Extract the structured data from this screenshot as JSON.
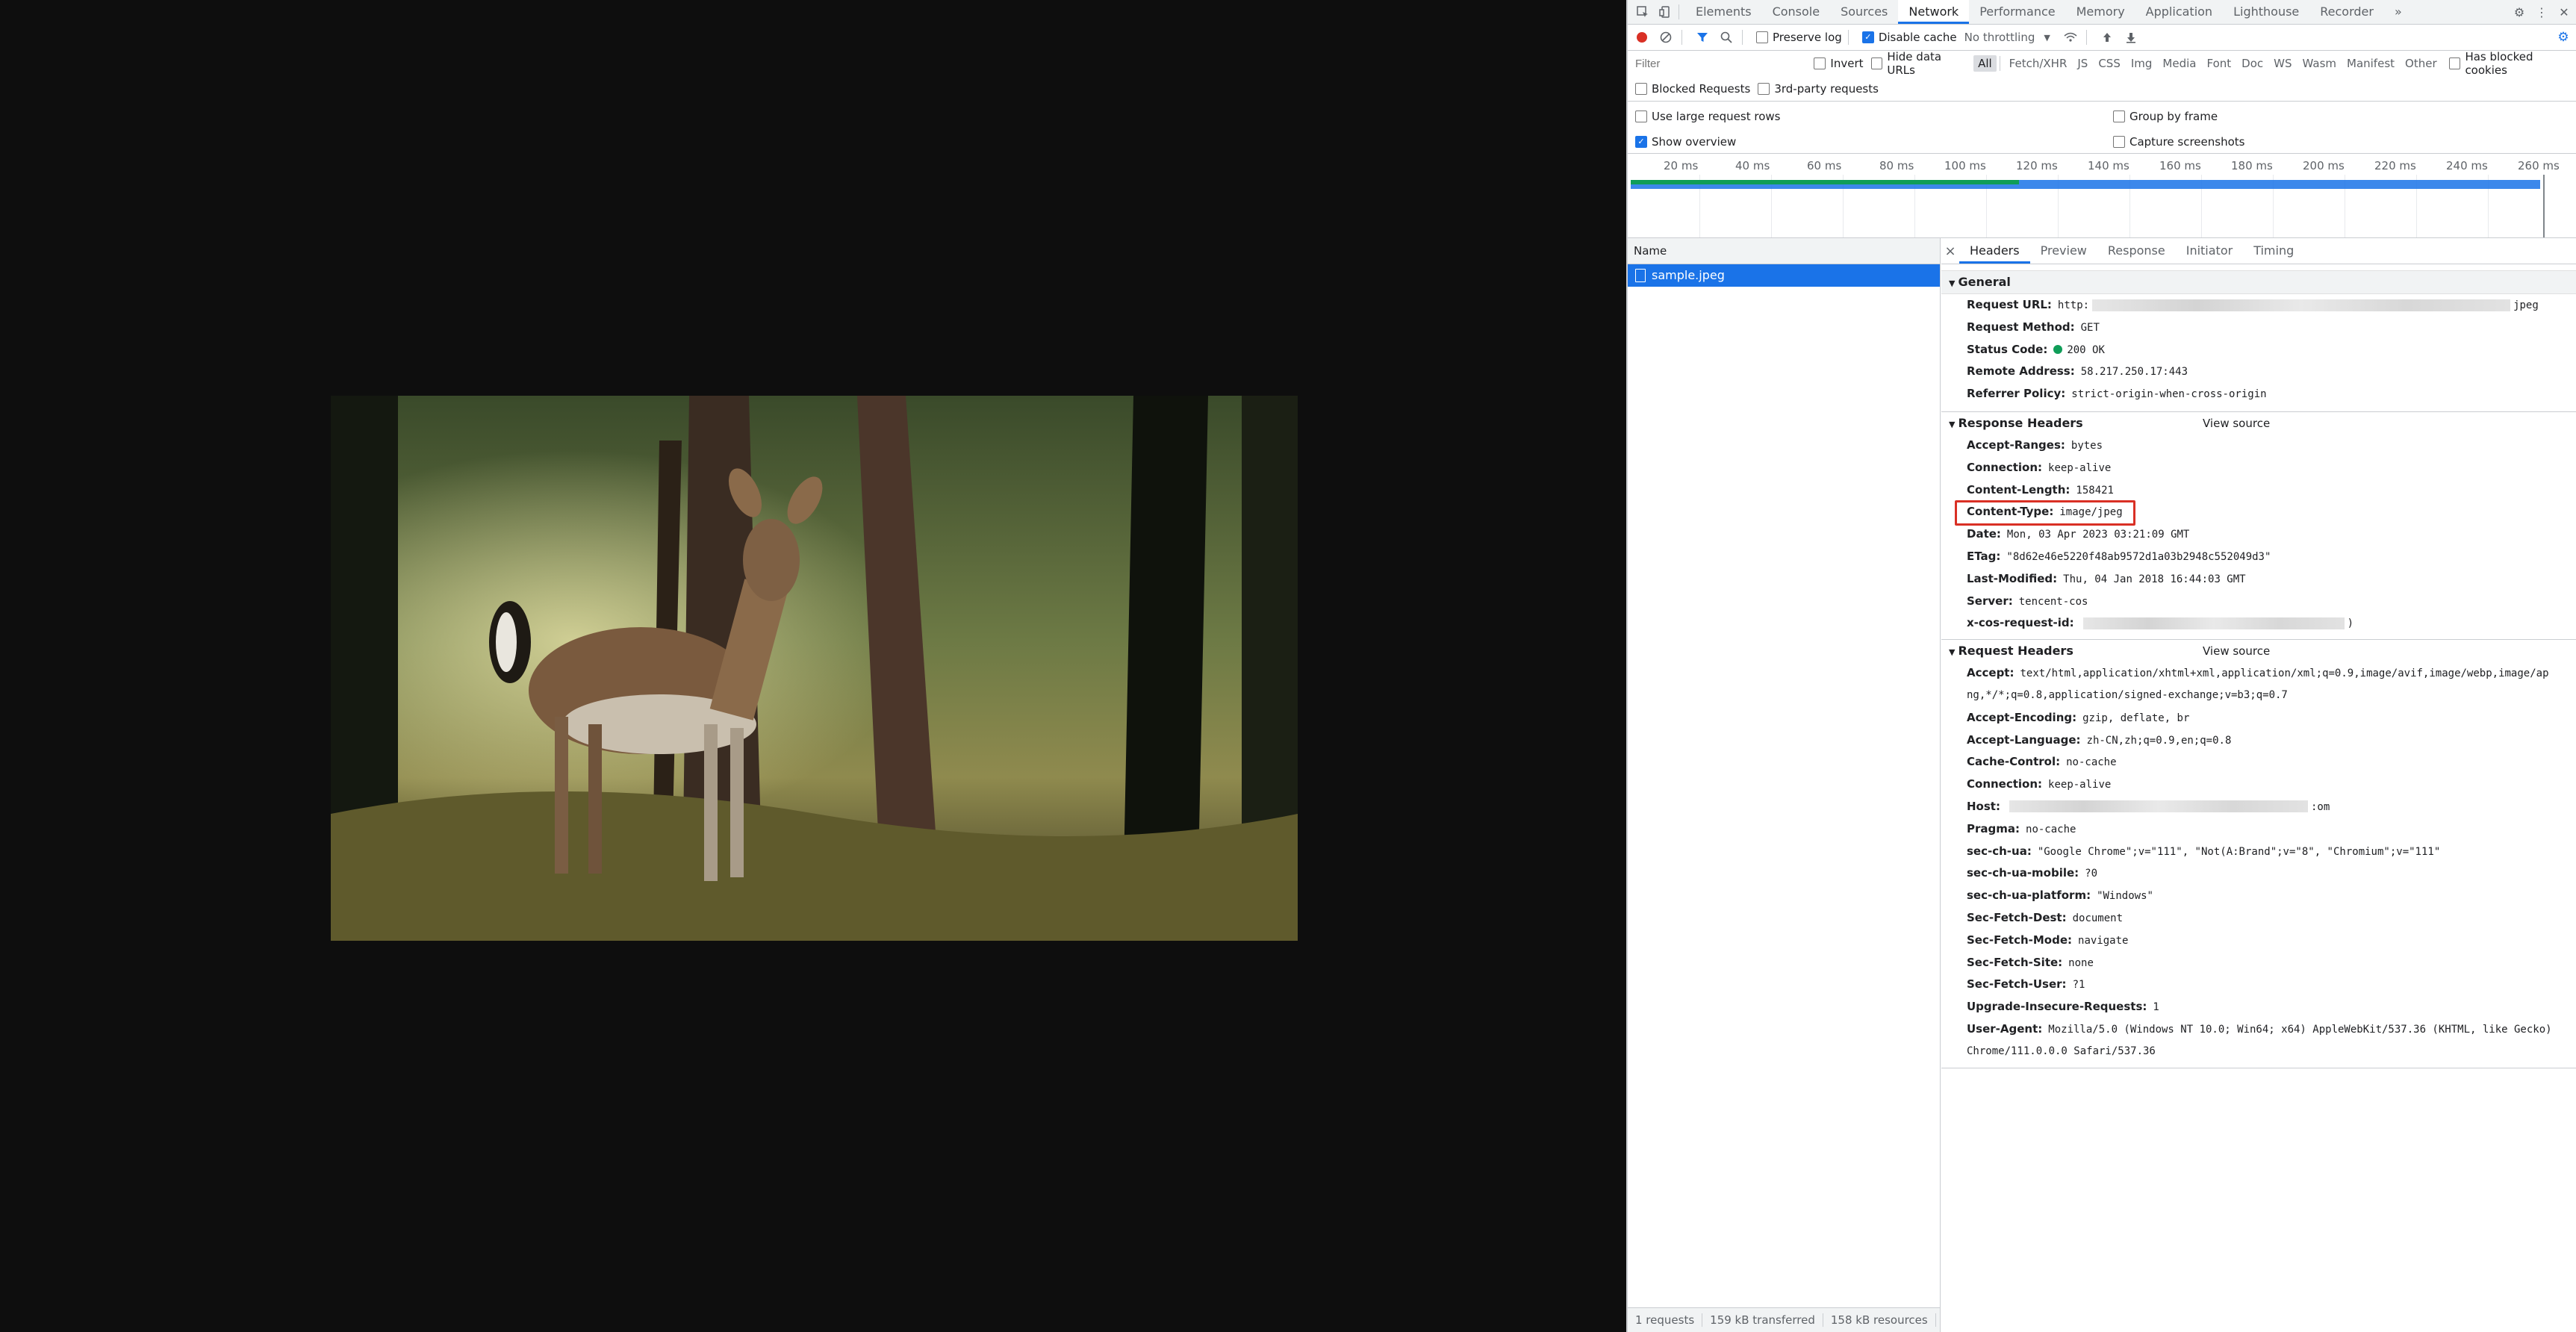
{
  "devtools": {
    "tabs": [
      "Elements",
      "Console",
      "Sources",
      "Network",
      "Performance",
      "Memory",
      "Application",
      "Lighthouse",
      "Recorder"
    ],
    "more_tabs": "»",
    "toolbar": {
      "preserve_log": "Preserve log",
      "disable_cache": "Disable cache",
      "throttling": "No throttling"
    },
    "filter": {
      "placeholder": "Filter",
      "invert": "Invert",
      "hide_data_urls": "Hide data URLs",
      "types": [
        "All",
        "Fetch/XHR",
        "JS",
        "CSS",
        "Img",
        "Media",
        "Font",
        "Doc",
        "WS",
        "Wasm",
        "Manifest",
        "Other"
      ],
      "has_blocked_cookies": "Has blocked cookies",
      "blocked_requests": "Blocked Requests",
      "third_party": "3rd-party requests"
    },
    "options": {
      "large_rows": "Use large request rows",
      "group_by_frame": "Group by frame",
      "show_overview": "Show overview",
      "capture_screenshots": "Capture screenshots"
    },
    "timeline_ticks": [
      "20 ms",
      "40 ms",
      "60 ms",
      "80 ms",
      "100 ms",
      "120 ms",
      "140 ms",
      "160 ms",
      "180 ms",
      "200 ms",
      "220 ms",
      "240 ms",
      "260 ms"
    ],
    "request_list": {
      "header": "Name",
      "items": [
        "sample.jpeg"
      ]
    },
    "status": {
      "requests": "1 requests",
      "transferred": "159 kB transferred",
      "resources": "158 kB resources"
    },
    "details": {
      "tabs": [
        "Headers",
        "Preview",
        "Response",
        "Initiator",
        "Timing"
      ],
      "general": {
        "title": "General",
        "request_url_key": "Request URL:",
        "request_url_prefix": "http:",
        "request_url_suffix": "jpeg",
        "request_method_key": "Request Method:",
        "request_method": "GET",
        "status_code_key": "Status Code:",
        "status_code": "200 OK",
        "remote_address_key": "Remote Address:",
        "remote_address": "58.217.250.17:443",
        "referrer_policy_key": "Referrer Policy:",
        "referrer_policy": "strict-origin-when-cross-origin"
      },
      "response_headers": {
        "title": "Response Headers",
        "view_source": "View source",
        "items": [
          {
            "k": "Accept-Ranges:",
            "v": "bytes"
          },
          {
            "k": "Connection:",
            "v": "keep-alive"
          },
          {
            "k": "Content-Length:",
            "v": "158421"
          },
          {
            "k": "Content-Type:",
            "v": "image/jpeg"
          },
          {
            "k": "Date:",
            "v": "Mon, 03 Apr 2023 03:21:09 GMT"
          },
          {
            "k": "ETag:",
            "v": "\"8d62e46e5220f48ab9572d1a03b2948c552049d3\""
          },
          {
            "k": "Last-Modified:",
            "v": "Thu, 04 Jan 2018 16:44:03 GMT"
          },
          {
            "k": "Server:",
            "v": "tencent-cos"
          },
          {
            "k": "x-cos-request-id:",
            "v": ")"
          }
        ]
      },
      "request_headers": {
        "title": "Request Headers",
        "view_source": "View source",
        "accept_key": "Accept:",
        "accept_line1": "text/html,application/xhtml+xml,application/xml;q=0.9,image/avif,image/webp,image/ap",
        "accept_line2": "ng,*/*;q=0.8,application/signed-exchange;v=b3;q=0.7",
        "items": [
          {
            "k": "Accept-Encoding:",
            "v": "gzip, deflate, br"
          },
          {
            "k": "Accept-Language:",
            "v": "zh-CN,zh;q=0.9,en;q=0.8"
          },
          {
            "k": "Cache-Control:",
            "v": "no-cache"
          },
          {
            "k": "Connection:",
            "v": "keep-alive"
          }
        ],
        "host_key": "Host:",
        "host_suffix": ":om",
        "items2": [
          {
            "k": "Pragma:",
            "v": "no-cache"
          },
          {
            "k": "sec-ch-ua:",
            "v": "\"Google Chrome\";v=\"111\", \"Not(A:Brand\";v=\"8\", \"Chromium\";v=\"111\""
          },
          {
            "k": "sec-ch-ua-mobile:",
            "v": "?0"
          },
          {
            "k": "sec-ch-ua-platform:",
            "v": "\"Windows\""
          },
          {
            "k": "Sec-Fetch-Dest:",
            "v": "document"
          },
          {
            "k": "Sec-Fetch-Mode:",
            "v": "navigate"
          },
          {
            "k": "Sec-Fetch-Site:",
            "v": "none"
          },
          {
            "k": "Sec-Fetch-User:",
            "v": "?1"
          },
          {
            "k": "Upgrade-Insecure-Requests:",
            "v": "1"
          }
        ],
        "user_agent_key": "User-Agent:",
        "user_agent_line1": "Mozilla/5.0 (Windows NT 10.0; Win64; x64) AppleWebKit/537.36 (KHTML, like Gecko)",
        "user_agent_line2": "Chrome/111.0.0.0 Safari/537.36"
      }
    }
  }
}
